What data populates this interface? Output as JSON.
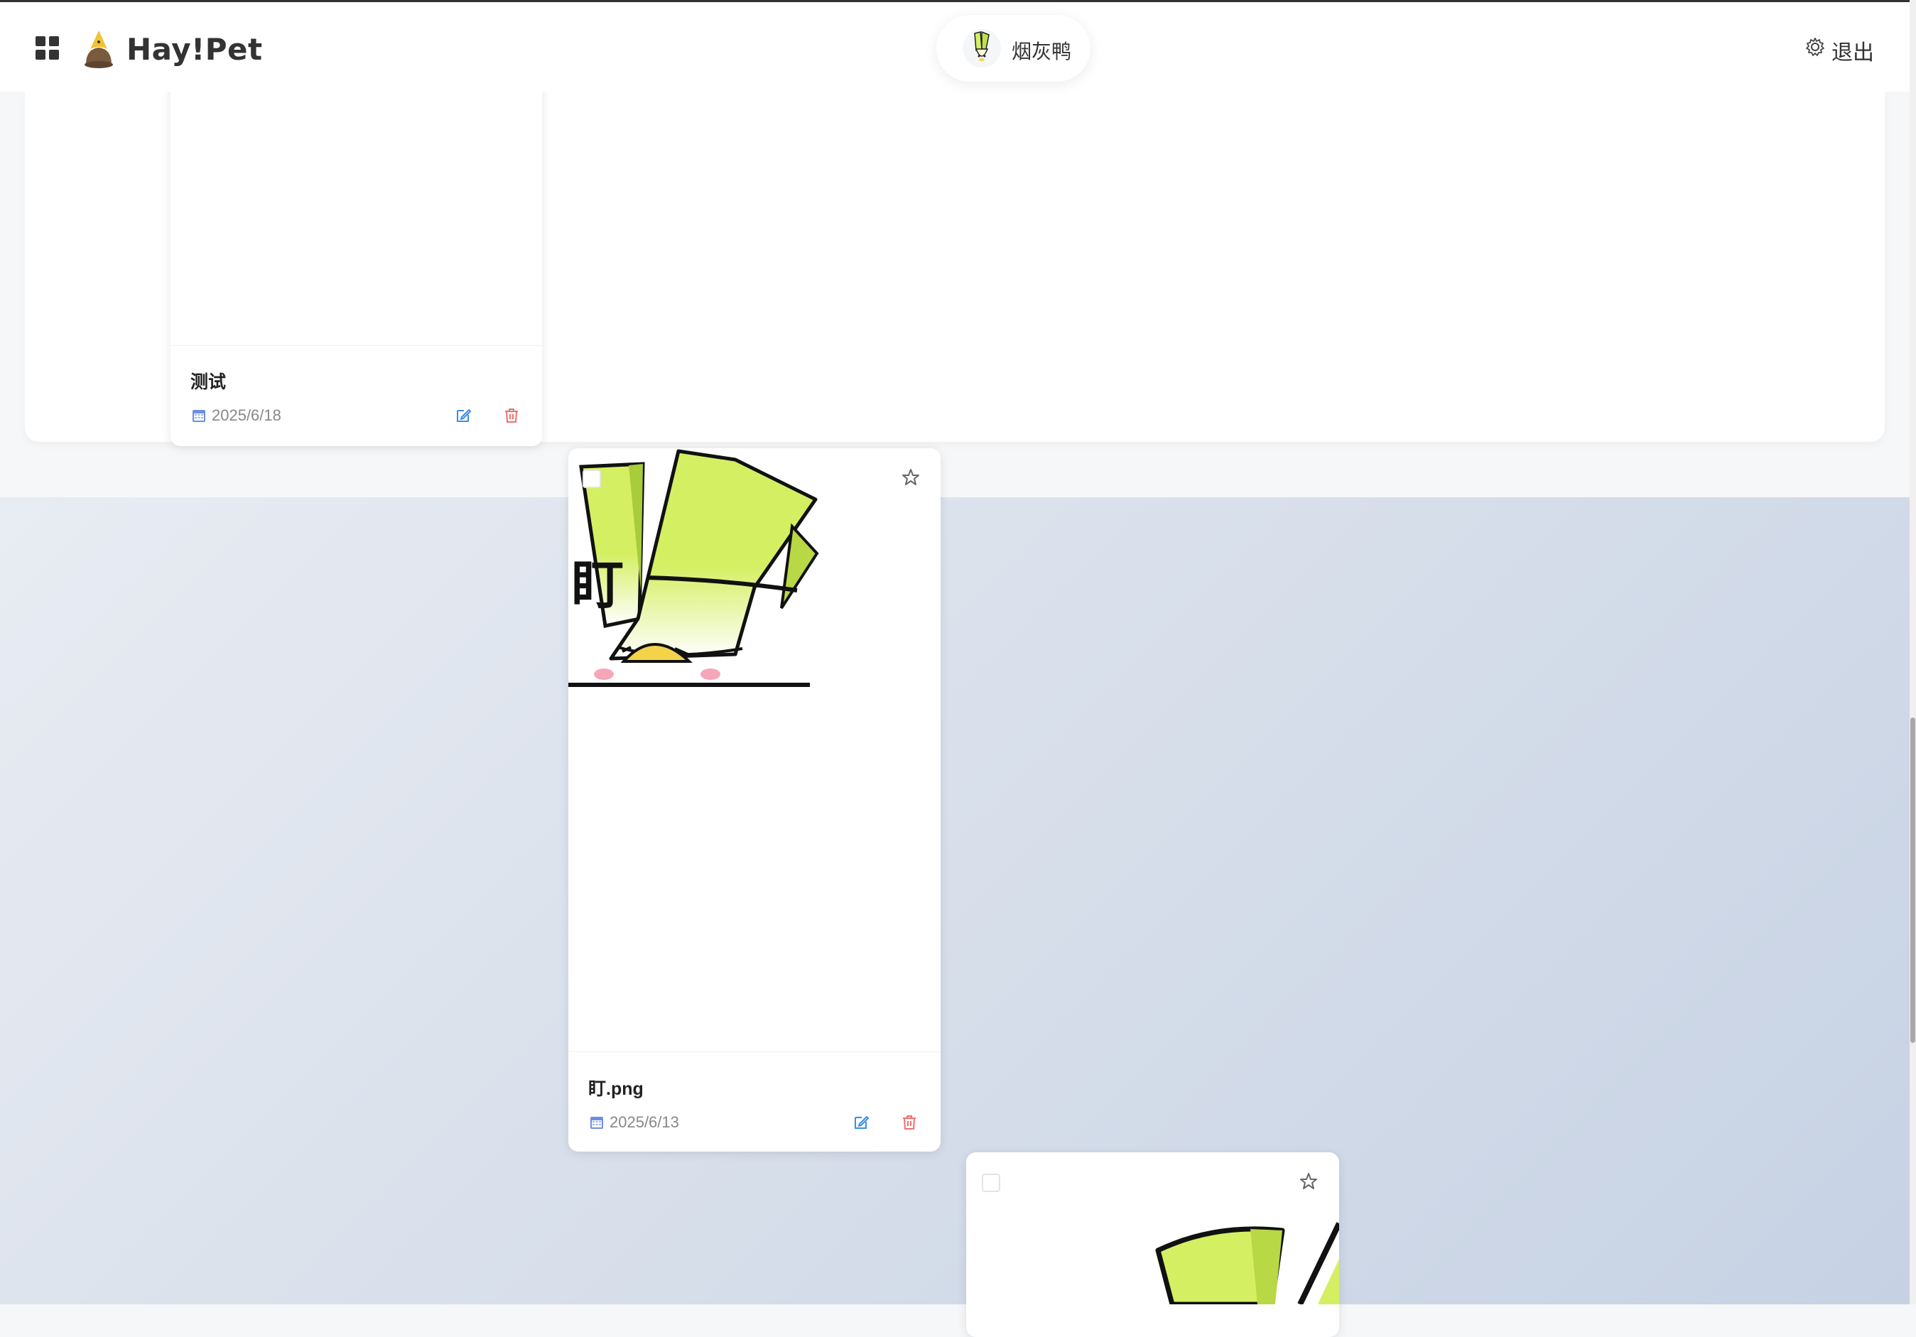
{
  "header": {
    "brand": "Hay!Pet",
    "user_name": "烟灰鸭",
    "logout_label": "退出",
    "icons": [
      "apps-grid-icon",
      "chick-logo-icon",
      "gear-icon"
    ]
  },
  "cards": [
    {
      "title": "测试",
      "date": "2025/6/18",
      "icons": [
        "calendar-icon",
        "edit-icon",
        "trash-icon"
      ]
    },
    {
      "title": "盯.png",
      "date": "2025/6/13",
      "image_caption": "盯",
      "icons": [
        "calendar-icon",
        "edit-icon",
        "trash-icon",
        "star-icon"
      ]
    },
    {
      "title": "",
      "date": "",
      "icons": [
        "star-icon"
      ]
    }
  ],
  "colors": {
    "edit": "#3a8ee6",
    "delete": "#f56c6c",
    "sticker_green": "#d4ef62",
    "page_gradient_start": "#e8ecf3",
    "page_gradient_end": "#c6d2e4"
  }
}
